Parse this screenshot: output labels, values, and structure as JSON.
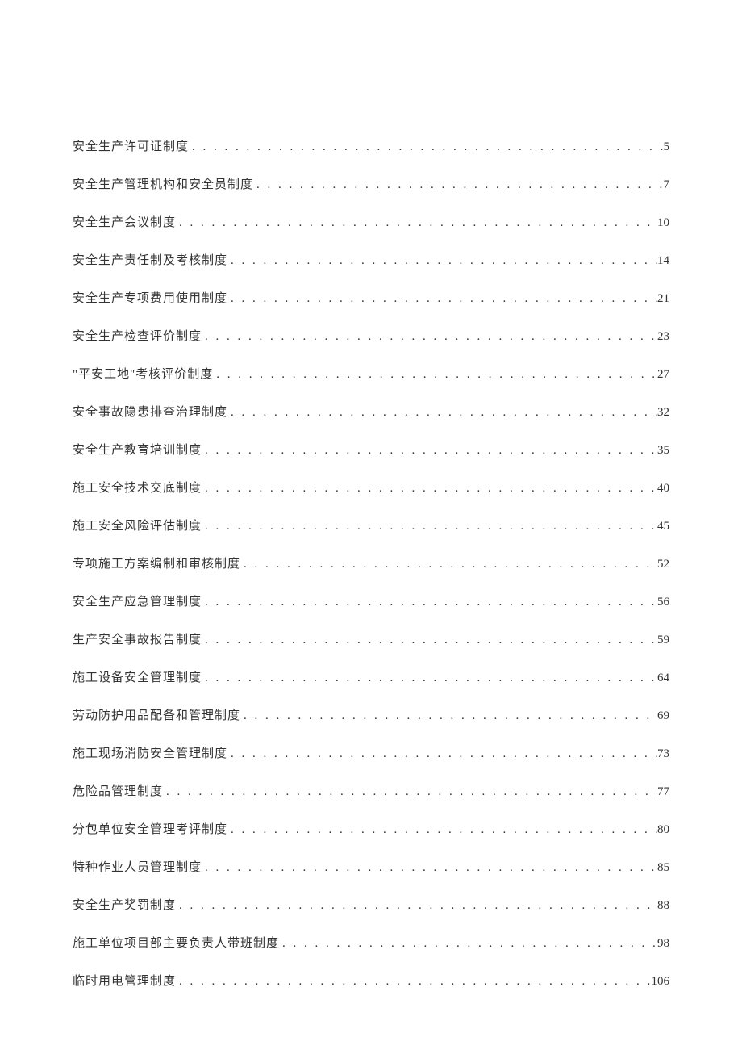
{
  "toc": {
    "entries": [
      {
        "title": "安全生产许可证制度",
        "page": "5"
      },
      {
        "title": "安全生产管理机构和安全员制度",
        "page": "7"
      },
      {
        "title": "安全生产会议制度",
        "page": "10"
      },
      {
        "title": "安全生产责任制及考核制度",
        "page": "14"
      },
      {
        "title": "安全生产专项费用使用制度",
        "page": "21"
      },
      {
        "title": "安全生产检查评价制度",
        "page": "23"
      },
      {
        "title": "\"平安工地\"考核评价制度",
        "page": "27"
      },
      {
        "title": "安全事故隐患排查治理制度",
        "page": "32"
      },
      {
        "title": "安全生产教育培训制度",
        "page": "35"
      },
      {
        "title": "施工安全技术交底制度",
        "page": "40"
      },
      {
        "title": "施工安全风险评估制度",
        "page": "45"
      },
      {
        "title": "专项施工方案编制和审核制度",
        "page": "52"
      },
      {
        "title": "安全生产应急管理制度",
        "page": "56"
      },
      {
        "title": "生产安全事故报告制度",
        "page": "59"
      },
      {
        "title": "施工设备安全管理制度",
        "page": "64"
      },
      {
        "title": "劳动防护用品配备和管理制度",
        "page": "69"
      },
      {
        "title": "施工现场消防安全管理制度",
        "page": "73"
      },
      {
        "title": "危险品管理制度",
        "page": "77"
      },
      {
        "title": "分包单位安全管理考评制度",
        "page": "80"
      },
      {
        "title": "特种作业人员管理制度",
        "page": "85"
      },
      {
        "title": "安全生产奖罚制度",
        "page": "88"
      },
      {
        "title": "施工单位项目部主要负责人带班制度",
        "page": "98"
      },
      {
        "title": "临时用电管理制度",
        "page": "106"
      }
    ]
  }
}
